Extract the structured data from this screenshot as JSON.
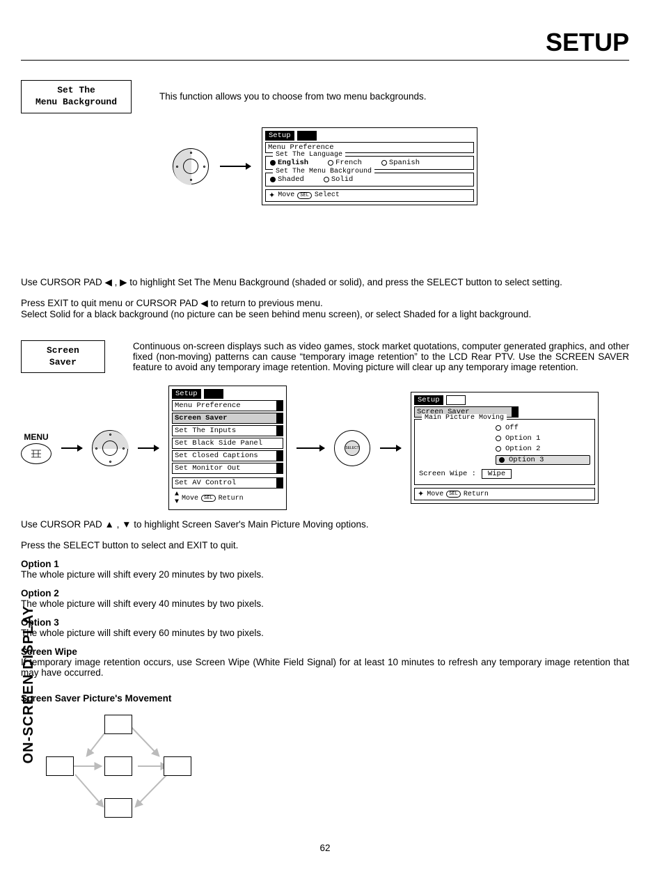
{
  "page_title": "SETUP",
  "side_tab": "ON-SCREEN DISPLAY",
  "page_number": "62",
  "menu_bg": {
    "button_l1": "Set The",
    "button_l2": "Menu Background",
    "intro": "This function allows you to choose from two menu backgrounds.",
    "osd": {
      "tab": "Setup",
      "subtab": "Menu Preference",
      "group1_title": "Set The Language",
      "lang_opts": {
        "english": "English",
        "french": "French",
        "spanish": "Spanish"
      },
      "group2_title": "Set The Menu Background",
      "bg_opts": {
        "shaded": "Shaded",
        "solid": "Solid"
      },
      "foot_move": "Move",
      "foot_sel": "Select",
      "foot_sel_icon": "SEL"
    },
    "p1": "Use CURSOR PAD ◀ , ▶ to highlight Set The Menu Background (shaded or solid), and press the SELECT button to select setting.",
    "p2": "Press EXIT to quit menu or CURSOR PAD ◀ to return to previous menu.",
    "p3": "Select Solid for a black background (no picture can be seen behind menu screen), or select Shaded for a light background."
  },
  "screen_saver": {
    "button_l1": "Screen",
    "button_l2": "Saver",
    "intro": "Continuous on-screen displays such as video games, stock market quotations, computer generated graphics, and other fixed (non-moving) patterns can cause “temporary image retention” to the LCD Rear PTV.  Use the SCREEN SAVER feature to avoid any temporary image retention.  Moving picture will clear up any temporary image retention.",
    "menu_label": "MENU",
    "osd1": {
      "tab": "Setup",
      "items": [
        "Menu Preference",
        "Screen Saver",
        "Set The Inputs",
        "Set Black Side Panel",
        "Set Closed Captions",
        "Set Monitor Out",
        "Set AV Control"
      ],
      "foot_move": "Move",
      "foot_return": "Return",
      "foot_sel_icon": "SEL"
    },
    "select_label": "SELECT",
    "osd2": {
      "tab": "Setup",
      "subtab": "Screen Saver",
      "group_title": "Main Picture Moving",
      "opts": {
        "off": "Off",
        "o1": "Option 1",
        "o2": "Option 2",
        "o3": "Option 3"
      },
      "wipe_label": "Screen Wipe :",
      "wipe_btn": "Wipe",
      "foot_move": "Move",
      "foot_return": "Return",
      "foot_sel_icon": "SEL"
    },
    "p_use": "Use CURSOR PAD ▲ , ▼ to highlight Screen Saver's Main Picture Moving options.",
    "p_press": "Press the SELECT button to select and EXIT to quit.",
    "opt1_h": "Option 1",
    "opt1_t": "The whole picture will shift every 20 minutes by two pixels.",
    "opt2_h": "Option 2",
    "opt2_t": "The whole picture will shift every 40 minutes by two pixels.",
    "opt3_h": "Option 3",
    "opt3_t": "The whole picture will shift every 60 minutes by two pixels.",
    "wipe_h": "Screen Wipe",
    "wipe_t": "If temporary image retention occurs, use Screen Wipe (White Field Signal) for at least 10 minutes to refresh any temporary image retention that may have occurred.",
    "move_h": "Screen Saver Picture's Movement"
  }
}
